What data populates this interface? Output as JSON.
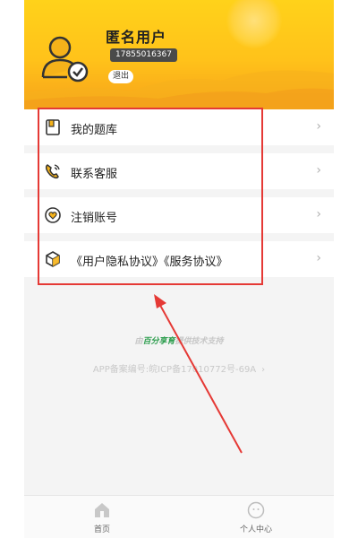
{
  "profile": {
    "name": "匿名用户",
    "phone": "17855016367",
    "logout_label": "退出"
  },
  "menu": {
    "items": [
      {
        "label": "我的题库",
        "icon": "book-icon"
      },
      {
        "label": "联系客服",
        "icon": "phone-icon"
      },
      {
        "label": "注销账号",
        "icon": "heart-badge-icon"
      },
      {
        "label": "《用户隐私协议》《服务协议》",
        "icon": "cube-icon"
      }
    ],
    "chevron": "›"
  },
  "footer": {
    "powered_prefix": "由",
    "powered_brand": "百分享育",
    "powered_suffix": "提供技术支持",
    "icp": "APP备案编号:皖ICP备17010772号-69A",
    "icp_chevron": "›"
  },
  "tabs": [
    {
      "label": "首页",
      "icon": "home-icon"
    },
    {
      "label": "个人中心",
      "icon": "user-icon"
    }
  ],
  "colors": {
    "header_yellow": "#ffc21a",
    "highlight_red": "#e53935",
    "brand_green": "#2e9e4f"
  }
}
